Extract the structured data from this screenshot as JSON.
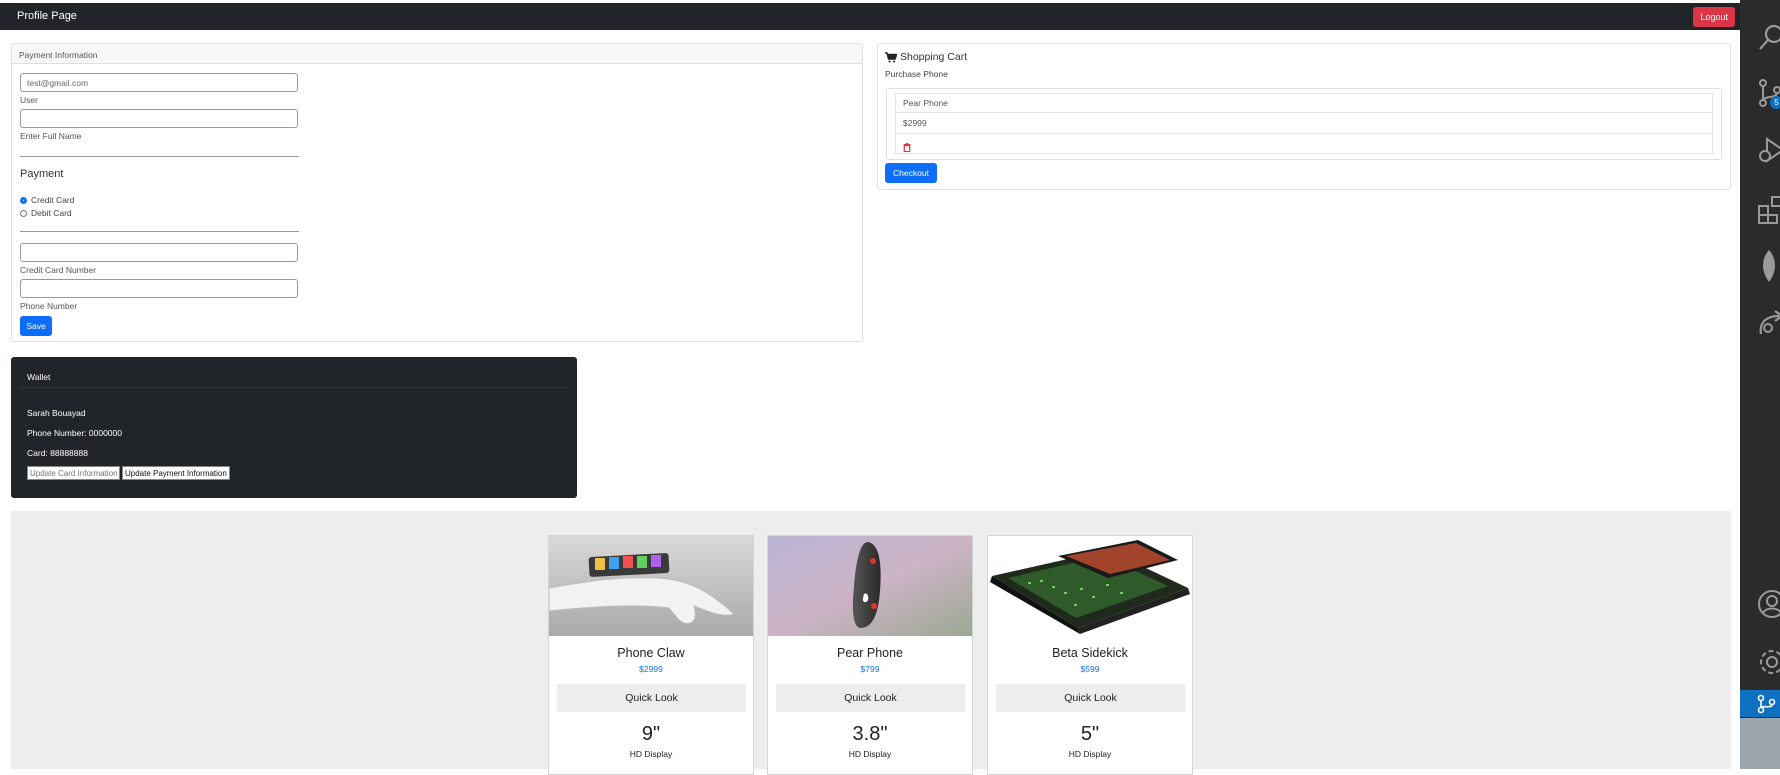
{
  "navbar": {
    "title": "Profile Page",
    "logout_label": "Logout"
  },
  "payment_form": {
    "header": "Payment Information",
    "email_value": "test@gmail.com",
    "user_label": "User",
    "full_name_label": "Enter Full Name",
    "payment_heading": "Payment",
    "options": [
      "Credit Card",
      "Debit Card"
    ],
    "selected_option": "Credit Card",
    "card_number_label": "Credit Card Number",
    "phone_label": "Phone Number",
    "save_label": "Save"
  },
  "cart": {
    "title": "Shopping Cart",
    "subtitle": "Purchase Phone",
    "item_name": "Pear Phone",
    "item_price": "$2999",
    "checkout_label": "Checkout"
  },
  "wallet": {
    "header": "Wallet",
    "name": "Sarah Bouayad",
    "phone": "Phone Number: 0000000",
    "card": "Card: 88888888",
    "update_card_placeholder": "Update Card Information",
    "update_payment_label": "Update Payment Information"
  },
  "products": [
    {
      "name": "Phone Claw",
      "price": "$2999",
      "quick_look": "Quick Look",
      "size": "9\"",
      "display": "HD Display"
    },
    {
      "name": "Pear Phone",
      "price": "$799",
      "quick_look": "Quick Look",
      "size": "3.8\"",
      "display": "HD Display"
    },
    {
      "name": "Beta Sidekick",
      "price": "$599",
      "quick_look": "Quick Look",
      "size": "5\"",
      "display": "HD Display"
    }
  ],
  "sidebar": {
    "badge": "5"
  }
}
